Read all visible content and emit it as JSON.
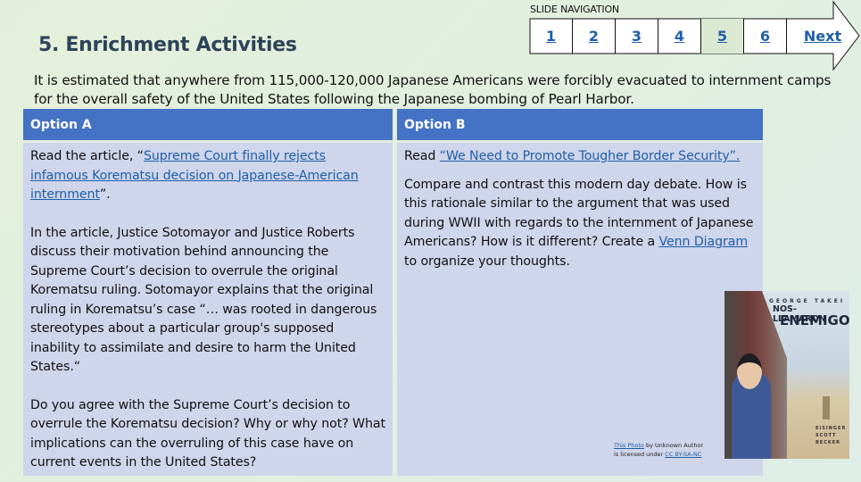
{
  "header": {
    "title": "5. Enrichment Activities"
  },
  "navigation": {
    "label": "SLIDE NAVIGATION",
    "items": [
      {
        "label": "1",
        "active": false
      },
      {
        "label": "2",
        "active": false
      },
      {
        "label": "3",
        "active": false
      },
      {
        "label": "4",
        "active": false
      },
      {
        "label": "5",
        "active": true
      },
      {
        "label": "6",
        "active": false
      }
    ],
    "next_label": "Next",
    "link_color": "#1f5fa8",
    "active_color": "#dbe8d2"
  },
  "intro": "It is estimated that anywhere from 115,000-120,000 Japanese Americans were forcibly evacuated to internment camps for the overall safety of the United States following the Japanese bombing of Pearl Harbor.",
  "table": {
    "header_color": "#4472c4",
    "cell_color": "#cfd5ea",
    "option_a": {
      "header": "Option A",
      "p1_prefix": "Read the article, “",
      "p1_link": "Supreme Court finally rejects infamous Korematsu decision on Japanese-American internment",
      "p1_suffix": "”.",
      "p2": "In the article, Justice Sotomayor and Justice Roberts discuss their motivation behind announcing the Supreme Court’s decision to overrule the original Korematsu ruling. Sotomayor explains that the original ruling in Korematsu’s case “… was rooted in dangerous stereotypes about a particular group's supposed inability to assimilate and desire to harm the United States.“",
      "p3": "Do you agree with the Supreme Court’s decision to overrule the Korematsu decision? Why or why not? What implications can the overruling of this case have on current events in the United States?"
    },
    "option_b": {
      "header": "Option B",
      "p1_prefix": "Read ",
      "p1_link": "“We Need to Promote Tougher Border Security”.",
      "p2_prefix": "Compare and contrast this modern day debate. How is this rationale similar to the argument that was used during WWII with regards to the internment of Japanese Americans? How is it different? Create a ",
      "p2_link": "Venn Diagram",
      "p2_suffix": " to organize your thoughts."
    }
  },
  "image": {
    "author": "GEORGE TAKEI",
    "title_line1": "NOS-LLAMARON",
    "title_line2": "ENEMIGO",
    "credits": "EISINGER SCOTT BECKER",
    "attribution": {
      "link1": "This Photo",
      "text1": " by Unknown Author",
      "text2": "is licensed under ",
      "link2": "CC BY-SA-NC"
    }
  }
}
